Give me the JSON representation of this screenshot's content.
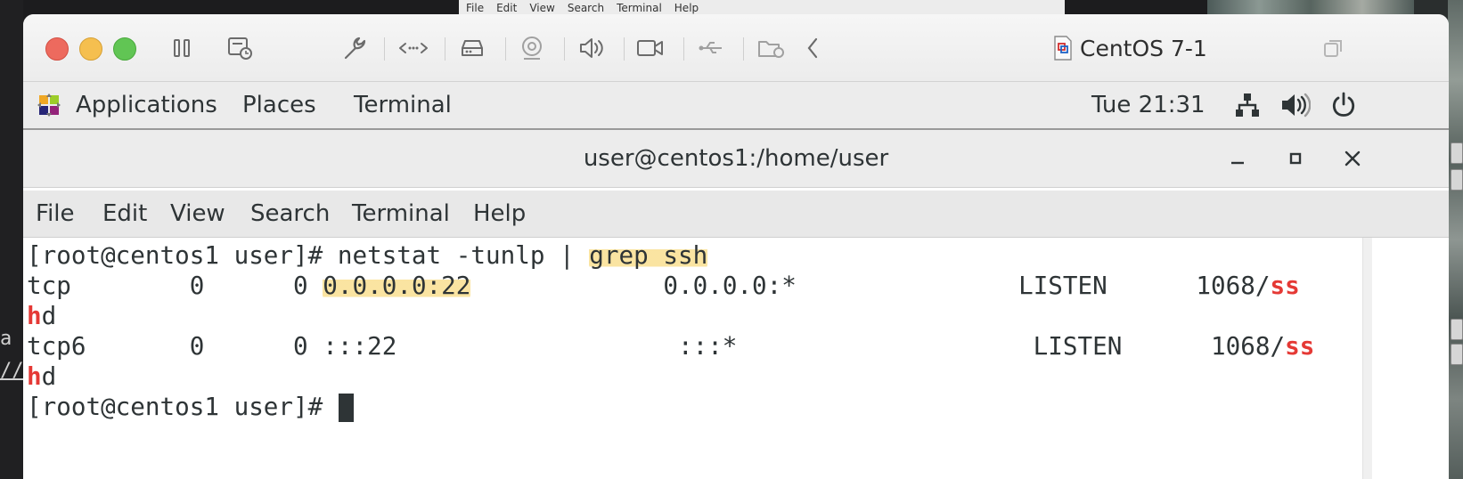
{
  "background": {
    "host_menu": [
      "File",
      "Edit",
      "View",
      "Search",
      "Terminal",
      "Help"
    ],
    "left_fragments": [
      "a",
      "//b"
    ]
  },
  "vm_window": {
    "title": "CentOS 7-1",
    "toolbar_icons": [
      "pause-icon",
      "snapshot-icon",
      "settings-icon",
      "network-arrows-icon",
      "hard-disk-icon",
      "camera-icon",
      "sound-icon",
      "video-camera-icon",
      "usb-icon",
      "shared-folder-icon",
      "back-chevron-icon"
    ],
    "restore_icon": "window-restore-icon"
  },
  "gnome_bar": {
    "applications": "Applications",
    "places": "Places",
    "terminal": "Terminal",
    "clock": "Tue 21:31"
  },
  "terminal": {
    "title": "user@centos1:/home/user",
    "menu": [
      "File",
      "Edit",
      "View",
      "Search",
      "Terminal",
      "Help"
    ],
    "lines": {
      "l1_prompt": "[root@centos1 user]# netstat -tunlp | ",
      "l1_highlight": "grep ssh",
      "l2_proto": "tcp        0      0 ",
      "l2_local": "0.0.0.0:22",
      "l2_rest": "             0.0.0.0:*               LISTEN      1068/",
      "l2_ss": "ss",
      "l3_h": "h",
      "l3_d": "d",
      "l4_main": "tcp6       0      0 :::22                   :::*                    LISTEN      1068/",
      "l4_ss": "ss",
      "l5_h": "h",
      "l5_d": "d",
      "l6_prompt": "[root@centos1 user]# "
    }
  },
  "colors": {
    "accent_red": "#e53935",
    "highlight_yellow": "#f8db82"
  }
}
